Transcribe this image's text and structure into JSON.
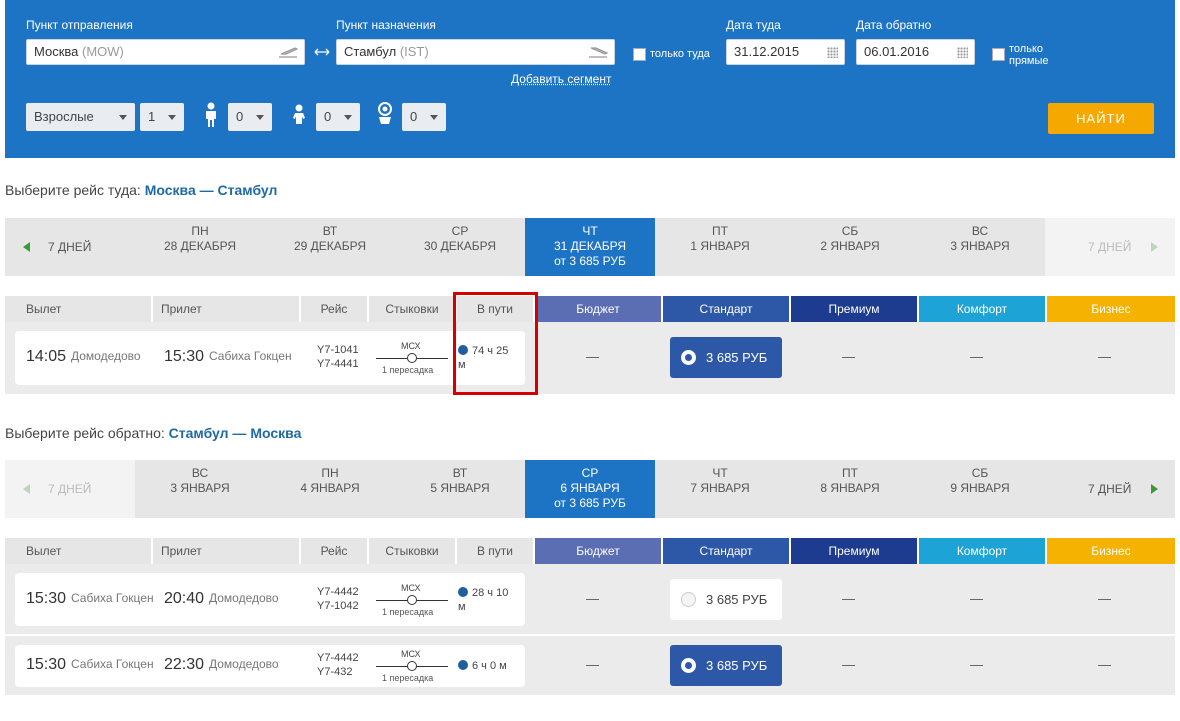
{
  "search": {
    "origin_label": "Пункт отправления",
    "origin_city": "Москва",
    "origin_code": "(MOW)",
    "destination_label": "Пункт назначения",
    "destination_city": "Стамбул",
    "destination_code": "(IST)",
    "oneway_label": "только туда",
    "depart_label": "Дата туда",
    "depart_value": "31.12.2015",
    "return_label": "Дата обратно",
    "return_value": "06.01.2016",
    "direct_label_1": "только",
    "direct_label_2": "прямые",
    "add_segment": "Добавить сегмент",
    "passenger_type": "Взрослые",
    "adults": "1",
    "children": "0",
    "infants": "0",
    "infants_seat": "0",
    "find_button": "НАЙТИ"
  },
  "outbound": {
    "title_prefix": "Выберите рейс туда:",
    "title_route": "Москва — Стамбул",
    "prev_label": "7 ДНЕЙ",
    "next_label": "7 ДНЕЙ",
    "days": [
      {
        "dow": "ПН",
        "date": "28 ДЕКАБРЯ",
        "price": ""
      },
      {
        "dow": "ВТ",
        "date": "29 ДЕКАБРЯ",
        "price": ""
      },
      {
        "dow": "СР",
        "date": "30 ДЕКАБРЯ",
        "price": ""
      },
      {
        "dow": "ЧТ",
        "date": "31 ДЕКАБРЯ",
        "price": "от 3 685 РУБ"
      },
      {
        "dow": "ПТ",
        "date": "1 ЯНВАРЯ",
        "price": ""
      },
      {
        "dow": "СБ",
        "date": "2 ЯНВАРЯ",
        "price": ""
      },
      {
        "dow": "ВС",
        "date": "3 ЯНВАРЯ",
        "price": ""
      }
    ],
    "flights": [
      {
        "dep_time": "14:05",
        "dep_airport": "Домодедово",
        "arr_time": "15:30",
        "arr_airport": "Сабиха Гокцен",
        "flight1": "Y7-1041",
        "flight2": "Y7-4441",
        "stop_code": "МСХ",
        "stop_text": "1 пересадка",
        "duration_1": "74 ч 25",
        "duration_2": "м",
        "budget": "—",
        "standard": "3 685 РУБ",
        "premium": "—",
        "comfort": "—",
        "business": "—"
      }
    ]
  },
  "columns": {
    "departure": "Вылет",
    "arrival": "Прилет",
    "flight": "Рейс",
    "stops": "Стыковки",
    "duration": "В пути",
    "budget": "Бюджет",
    "standard": "Стандарт",
    "premium": "Премиум",
    "comfort": "Комфорт",
    "business": "Бизнес"
  },
  "inbound": {
    "title_prefix": "Выберите рейс обратно:",
    "title_route": "Стамбул — Москва",
    "prev_label": "7 ДНЕЙ",
    "next_label": "7 ДНЕЙ",
    "days": [
      {
        "dow": "ВС",
        "date": "3 ЯНВАРЯ",
        "price": ""
      },
      {
        "dow": "ПН",
        "date": "4 ЯНВАРЯ",
        "price": ""
      },
      {
        "dow": "ВТ",
        "date": "5 ЯНВАРЯ",
        "price": ""
      },
      {
        "dow": "СР",
        "date": "6 ЯНВАРЯ",
        "price": "от 3 685 РУБ"
      },
      {
        "dow": "ЧТ",
        "date": "7 ЯНВАРЯ",
        "price": ""
      },
      {
        "dow": "ПТ",
        "date": "8 ЯНВАРЯ",
        "price": ""
      },
      {
        "dow": "СБ",
        "date": "9 ЯНВАРЯ",
        "price": ""
      }
    ],
    "flights": [
      {
        "dep_time": "15:30",
        "dep_airport": "Сабиха Гокцен",
        "arr_time": "20:40",
        "arr_airport": "Домодедово",
        "flight1": "Y7-4442",
        "flight2": "Y7-1042",
        "stop_code": "МСХ",
        "stop_text": "1 пересадка",
        "duration_1": "28 ч 10",
        "duration_2": "м",
        "budget": "—",
        "standard": "3 685 РУБ",
        "premium": "—",
        "comfort": "—",
        "business": "—"
      },
      {
        "dep_time": "15:30",
        "dep_airport": "Сабиха Гокцен",
        "arr_time": "22:30",
        "arr_airport": "Домодедово",
        "flight1": "Y7-4442",
        "flight2": "Y7-432",
        "stop_code": "МСХ",
        "stop_text": "1 пересадка",
        "duration_1": "6 ч 0 м",
        "duration_2": "",
        "budget": "—",
        "standard": "3 685 РУБ",
        "premium": "—",
        "comfort": "—",
        "business": "—"
      }
    ]
  },
  "colors": {
    "panel": "#1e74c4",
    "budget": "#5b6db3",
    "standard": "#2d58a8",
    "premium": "#1d3b8f",
    "comfort": "#1ea3d6",
    "business": "#f5b200",
    "find": "#f5a800",
    "highlight": "#d40000"
  }
}
